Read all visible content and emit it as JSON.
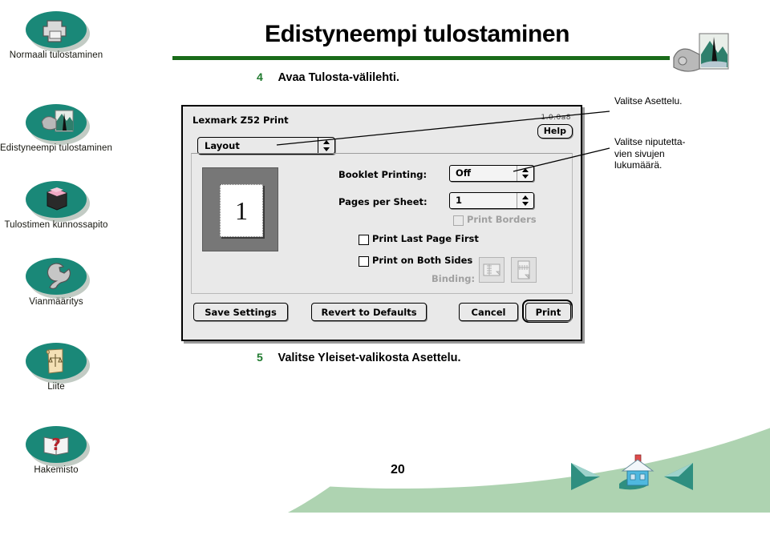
{
  "page": {
    "title": "Edistyneempi tulostaminen",
    "page_number": "20",
    "accent_green": "#1a6b1a",
    "panel_green": "#aed3b1",
    "oval_teal": "#1a8878",
    "step_number_color": "#1f7a2e"
  },
  "sidebar": {
    "items": [
      {
        "label": "Normaali tulostaminen",
        "icon": "printer-icon"
      },
      {
        "label": "Edistyneempi tulostaminen",
        "icon": "camera-photo-icon"
      },
      {
        "label": "Tulostimen kunnossapito",
        "icon": "ink-cartridge-icon"
      },
      {
        "label": "Vianmääritys",
        "icon": "wrench-icon"
      },
      {
        "label": "Liite",
        "icon": "scroll-scales-icon"
      },
      {
        "label": "Hakemisto",
        "icon": "question-book-icon"
      }
    ]
  },
  "steps": [
    {
      "number": "4",
      "text": "Avaa Tulosta-välilehti."
    },
    {
      "number": "5",
      "text": "Valitse Yleiset-valikosta Asettelu."
    }
  ],
  "callouts": [
    {
      "text": "Valitse Asettelu."
    },
    {
      "text": "Valitse niputetta- vien sivujen lukumäärä."
    }
  ],
  "dialog": {
    "title": "Lexmark Z52 Print",
    "version": "1.0.0a8",
    "help_label": "Help",
    "pane_popup": {
      "value": "Layout"
    },
    "preview": {
      "page_label": "1"
    },
    "fields": [
      {
        "label": "Booklet Printing:",
        "value": "Off"
      },
      {
        "label": "Pages per Sheet:",
        "value": "1"
      }
    ],
    "checkboxes": [
      {
        "label": "Print Borders",
        "checked": false,
        "disabled": true
      },
      {
        "label": "Print Last Page First",
        "checked": false,
        "disabled": false
      },
      {
        "label": "Print on Both Sides",
        "checked": false,
        "disabled": false
      }
    ],
    "binding_label": "Binding:",
    "buttons": [
      {
        "label": "Save Settings",
        "default": false
      },
      {
        "label": "Revert to Defaults",
        "default": false
      },
      {
        "label": "Cancel",
        "default": false
      },
      {
        "label": "Print",
        "default": true
      }
    ]
  },
  "footer": {
    "back_label": "back-arrow",
    "home_label": "home",
    "next_label": "next-arrow"
  }
}
